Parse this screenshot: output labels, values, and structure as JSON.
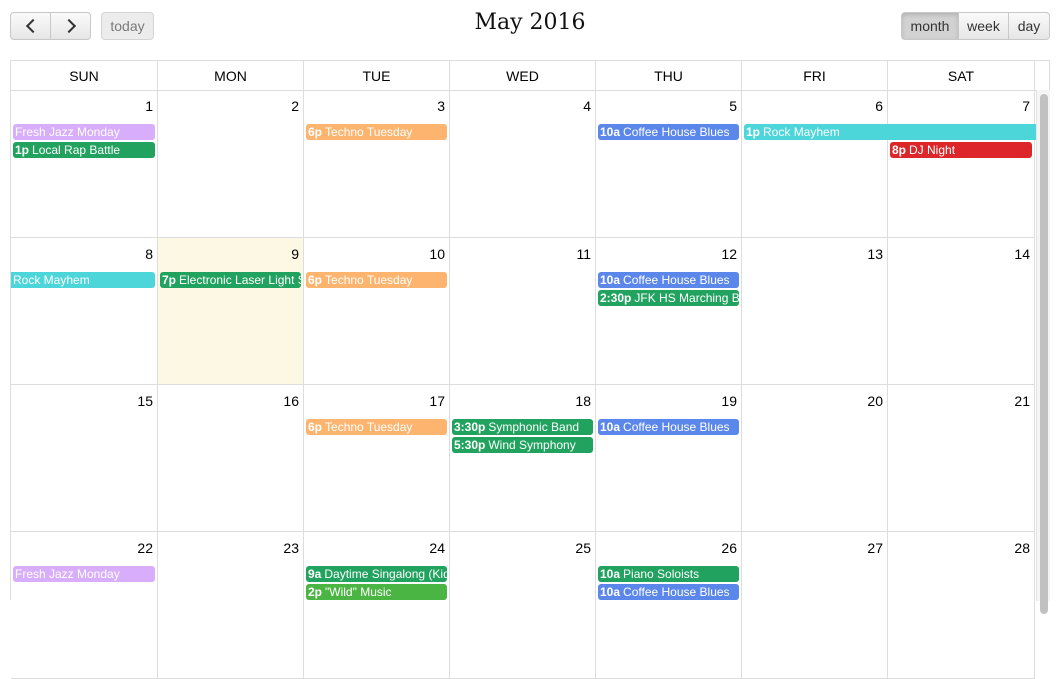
{
  "toolbar": {
    "prev_icon": "chevron-left-icon",
    "next_icon": "chevron-right-icon",
    "today_label": "today",
    "title": "May 2016",
    "views": [
      {
        "label": "month",
        "active": true
      },
      {
        "label": "week",
        "active": false
      },
      {
        "label": "day",
        "active": false
      }
    ]
  },
  "colors": {
    "purple": "#d8aefc",
    "green": "#21a35f",
    "orange": "#fdb46e",
    "blue": "#5b86ea",
    "teal": "#4cd6da",
    "red": "#dc2629",
    "lightgreen": "#4bb543",
    "today_bg": "#fcf8e3"
  },
  "weekdays": [
    "SUN",
    "MON",
    "TUE",
    "WED",
    "THU",
    "FRI",
    "SAT"
  ],
  "weeks": [
    {
      "days": [
        "1",
        "2",
        "3",
        "4",
        "5",
        "6",
        "7"
      ],
      "events": [
        {
          "start": 0,
          "span": 1,
          "row": 0,
          "time": "",
          "title": "Fresh Jazz Monday",
          "color": "purple"
        },
        {
          "start": 0,
          "span": 1,
          "row": 1,
          "time": "1p",
          "title": "Local Rap Battle",
          "color": "green"
        },
        {
          "start": 2,
          "span": 1,
          "row": 0,
          "time": "6p",
          "title": "Techno Tuesday",
          "color": "orange"
        },
        {
          "start": 4,
          "span": 1,
          "row": 0,
          "time": "10a",
          "title": "Coffee House Blues",
          "color": "blue"
        },
        {
          "start": 5,
          "span": 2,
          "row": 0,
          "time": "1p",
          "title": "Rock Mayhem",
          "color": "teal",
          "cont_right": true
        },
        {
          "start": 6,
          "span": 1,
          "row": 1,
          "time": "8p",
          "title": "DJ Night",
          "color": "red"
        }
      ]
    },
    {
      "days": [
        "8",
        "9",
        "10",
        "11",
        "12",
        "13",
        "14"
      ],
      "today_index": 1,
      "events": [
        {
          "start": 0,
          "span": 1,
          "row": 0,
          "time": "",
          "title": "Rock Mayhem",
          "color": "teal",
          "cont_left": true
        },
        {
          "start": 1,
          "span": 1,
          "row": 0,
          "time": "7p",
          "title": "Electronic Laser Light Show",
          "color": "green"
        },
        {
          "start": 2,
          "span": 1,
          "row": 0,
          "time": "6p",
          "title": "Techno Tuesday",
          "color": "orange"
        },
        {
          "start": 4,
          "span": 1,
          "row": 0,
          "time": "10a",
          "title": "Coffee House Blues",
          "color": "blue"
        },
        {
          "start": 4,
          "span": 1,
          "row": 1,
          "time": "2:30p",
          "title": "JFK HS Marching Band",
          "color": "green"
        }
      ]
    },
    {
      "days": [
        "15",
        "16",
        "17",
        "18",
        "19",
        "20",
        "21"
      ],
      "events": [
        {
          "start": 2,
          "span": 1,
          "row": 0,
          "time": "6p",
          "title": "Techno Tuesday",
          "color": "orange"
        },
        {
          "start": 3,
          "span": 1,
          "row": 0,
          "time": "3:30p",
          "title": "Symphonic Band",
          "color": "green"
        },
        {
          "start": 3,
          "span": 1,
          "row": 1,
          "time": "5:30p",
          "title": "Wind Symphony",
          "color": "green"
        },
        {
          "start": 4,
          "span": 1,
          "row": 0,
          "time": "10a",
          "title": "Coffee House Blues",
          "color": "blue"
        }
      ]
    },
    {
      "days": [
        "22",
        "23",
        "24",
        "25",
        "26",
        "27",
        "28"
      ],
      "events": [
        {
          "start": 0,
          "span": 1,
          "row": 0,
          "time": "",
          "title": "Fresh Jazz Monday",
          "color": "purple"
        },
        {
          "start": 2,
          "span": 1,
          "row": 0,
          "time": "9a",
          "title": "Daytime Singalong (Kids)",
          "color": "green"
        },
        {
          "start": 2,
          "span": 1,
          "row": 1,
          "time": "2p",
          "title": "\"Wild\" Music",
          "color": "lightgreen"
        },
        {
          "start": 4,
          "span": 1,
          "row": 0,
          "time": "10a",
          "title": "Piano Soloists",
          "color": "green"
        },
        {
          "start": 4,
          "span": 1,
          "row": 1,
          "time": "10a",
          "title": "Coffee House Blues",
          "color": "blue"
        }
      ]
    }
  ]
}
